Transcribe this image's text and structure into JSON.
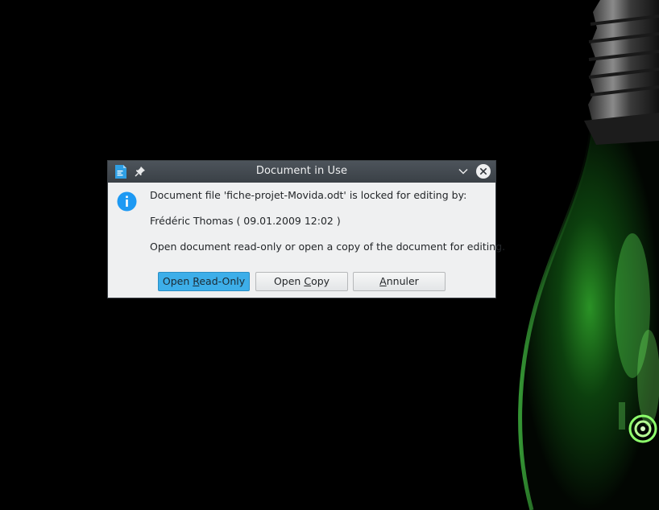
{
  "dialog": {
    "title": "Document in Use",
    "message_line_1": "Document file 'fiche-projet-Movida.odt' is locked for editing by:",
    "message_line_2": "Frédéric Thomas ( 09.01.2009 12:02 )",
    "message_line_3": "Open document read-only or open a copy of the document for editing.",
    "buttons": {
      "read_only": {
        "before": "Open ",
        "mnemonic": "R",
        "after": "ead-Only"
      },
      "copy": {
        "before": "Open ",
        "mnemonic": "C",
        "after": "opy"
      },
      "cancel": {
        "before": "",
        "mnemonic": "A",
        "after": "nnuler"
      }
    },
    "icons": {
      "app": "writer-document-icon",
      "pin": "pin-icon",
      "minimize": "chevron-down-icon",
      "close": "close-icon",
      "info": "info-icon"
    }
  },
  "colors": {
    "titlebar": "#3f454b",
    "dialog_bg": "#eff0f1",
    "accent": "#3daee9",
    "wallpaper_glow": "#39ff3a"
  }
}
